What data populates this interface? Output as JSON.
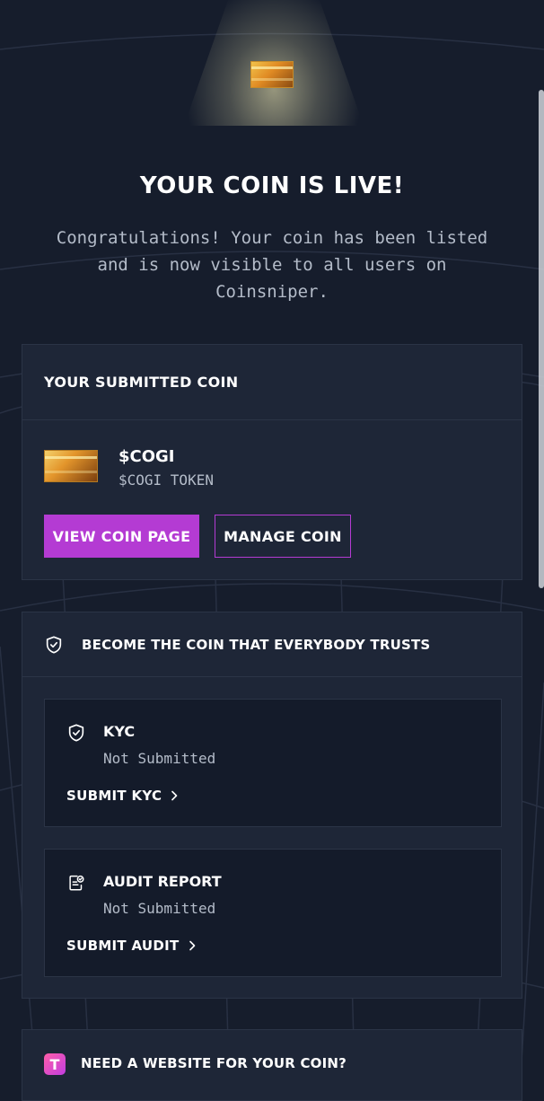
{
  "hero": {
    "title": "YOUR COIN IS LIVE!",
    "message": "Congratulations! Your coin has been listed and is now visible to all users on Coinsniper."
  },
  "submitted_coin": {
    "header": "YOUR SUBMITTED COIN",
    "name": "$COGI",
    "full_name": "$COGI TOKEN",
    "view_button": "VIEW COIN PAGE",
    "manage_button": "MANAGE COIN"
  },
  "trust": {
    "header": "BECOME THE COIN THAT EVERYBODY TRUSTS",
    "kyc": {
      "title": "KYC",
      "status": "Not Submitted",
      "action": "SUBMIT KYC"
    },
    "audit": {
      "title": "AUDIT REPORT",
      "status": "Not Submitted",
      "action": "SUBMIT AUDIT"
    }
  },
  "website": {
    "icon_letter": "T",
    "title": "NEED A WEBSITE FOR YOUR COIN?"
  },
  "icons": {
    "shield": "shield-check-icon",
    "audit": "audit-document-icon",
    "chevron": "chevron-right-icon",
    "website": "website-builder-icon"
  },
  "colors": {
    "background": "#161d2c",
    "card": "#1e2637",
    "accent": "#b43bd3",
    "muted_text": "#b4bcc9"
  }
}
